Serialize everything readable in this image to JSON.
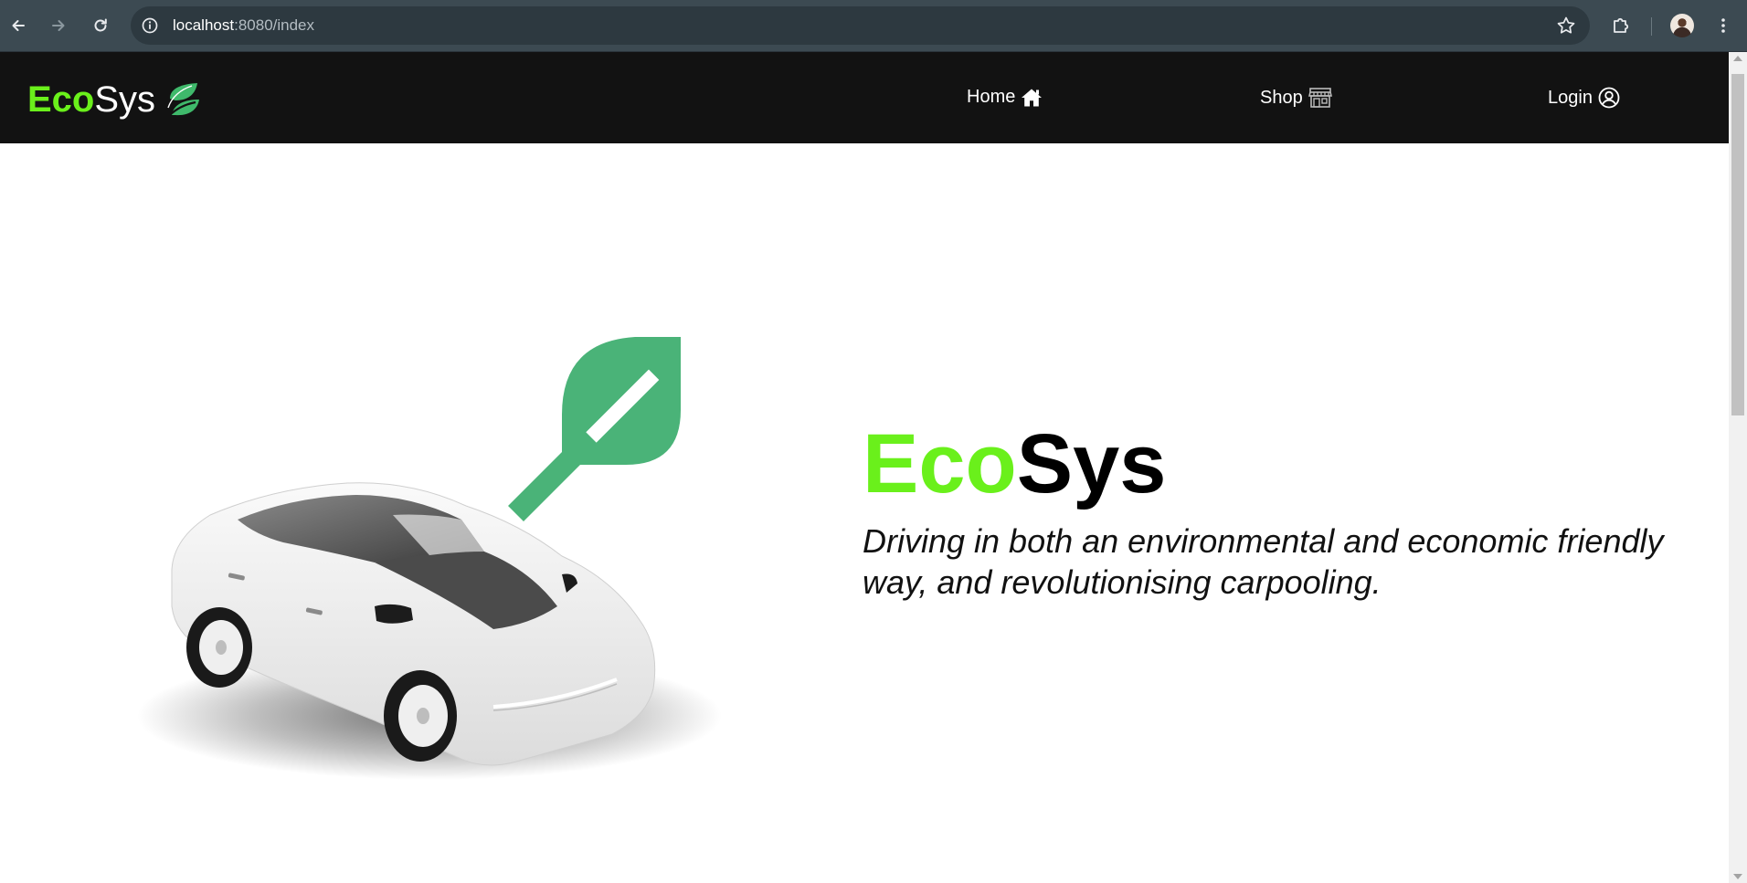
{
  "browser": {
    "url_host": "localhost",
    "url_rest": ":8080/index"
  },
  "site": {
    "brand": {
      "eco": "Eco",
      "sys": "Sys"
    },
    "nav": [
      {
        "label": "Home",
        "icon": "home-icon"
      },
      {
        "label": "Shop",
        "icon": "shop-icon"
      },
      {
        "label": "Login",
        "icon": "user-circle-icon"
      }
    ]
  },
  "hero": {
    "title_eco": "Eco",
    "title_sys": "Sys",
    "subtitle": "Driving in both an environmental and economic friendly way, and revolutionising carpooling."
  },
  "colors": {
    "accent_green": "#6af01b",
    "leaf_green": "#4ab378",
    "nav_bg": "#121212"
  }
}
